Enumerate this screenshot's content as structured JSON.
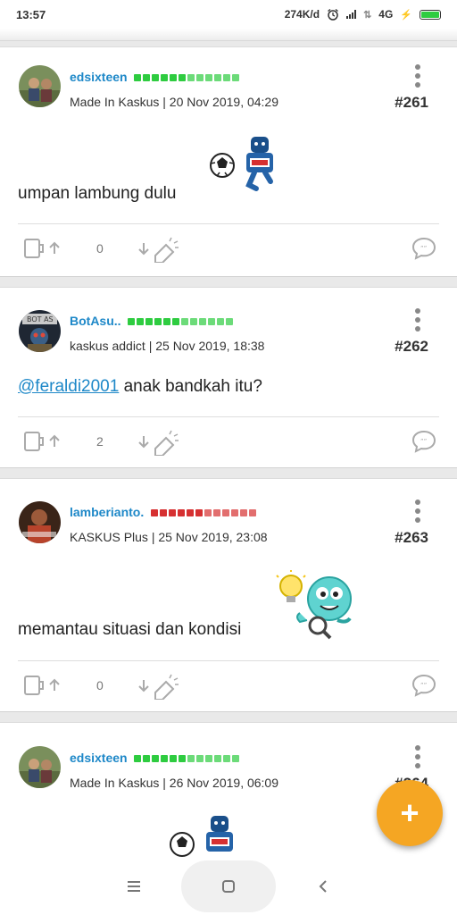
{
  "status_bar": {
    "time": "13:57",
    "net_speed": "274K/d",
    "network_type": "4G",
    "icons": [
      "alarm-icon",
      "signal-icon",
      "data-arrows-icon",
      "charging-icon",
      "battery-icon"
    ]
  },
  "posts": [
    {
      "username": "edsixteen",
      "rank_color": "#2ecc40",
      "rank_blocks": 12,
      "meta": "Made In Kaskus | 20 Nov 2019, 04:29",
      "post_number": "#261",
      "text": "umpan lambung dulu",
      "sticker": "soccer-mascot-sticker",
      "vote_count": "0"
    },
    {
      "username": "BotAsu..",
      "rank_color": "#2ecc40",
      "rank_blocks": 12,
      "meta": "kaskus addict | 25 Nov 2019, 18:38",
      "post_number": "#262",
      "mention": "@feraldi2001",
      "text": "anak bandkah itu?",
      "vote_count": "2"
    },
    {
      "username": "lamberianto.",
      "rank_color": "#d63031",
      "rank_blocks": 12,
      "meta": "KASKUS Plus | 25 Nov 2019, 23:08",
      "post_number": "#263",
      "text": "memantau situasi dan kondisi",
      "sticker": "idea-mascot-sticker",
      "vote_count": "0"
    },
    {
      "username": "edsixteen",
      "rank_color": "#2ecc40",
      "rank_blocks": 12,
      "meta": "Made In Kaskus | 26 Nov 2019, 06:09",
      "post_number": "#264",
      "sticker": "soccer-mascot-sticker"
    }
  ],
  "fab": {
    "label": "+"
  },
  "nav_bar": {
    "icons": [
      "menu-icon",
      "home-icon",
      "back-icon"
    ]
  }
}
